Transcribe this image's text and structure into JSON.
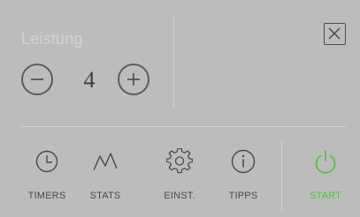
{
  "power": {
    "label": "Leistung",
    "value": "4",
    "decrease_icon": "minus-icon",
    "increase_icon": "plus-icon"
  },
  "window": {
    "close_icon": "close-icon"
  },
  "nav": {
    "items": [
      {
        "label": "TIMERS",
        "icon": "clock-icon"
      },
      {
        "label": "STATS",
        "icon": "chart-line-icon"
      },
      {
        "label": "EINST.",
        "icon": "gear-icon"
      },
      {
        "label": "TIPPS",
        "icon": "info-icon"
      },
      {
        "label": "START",
        "icon": "power-icon"
      }
    ]
  },
  "colors": {
    "background": "#bdbcbd",
    "label_light": "#d4d3d4",
    "icon_dark": "#4a4a4a",
    "start_green": "#4cc232"
  }
}
